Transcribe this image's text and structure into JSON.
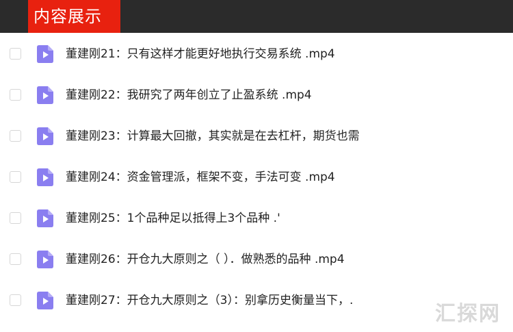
{
  "header": {
    "tab_label": "内容展示"
  },
  "files": [
    {
      "name": "董建刚21：只有这样才能更好地执行交易系统 .mp4"
    },
    {
      "name": "董建刚22：我研究了两年创立了止盈系统 .mp4"
    },
    {
      "name": "董建刚23：计算最大回撤，其实就是在去杠杆，期货也需"
    },
    {
      "name": "董建刚24：资金管理派，框架不变，手法可变 .mp4"
    },
    {
      "name": "董建刚25：1个品种足以抵得上3个品种 .'"
    },
    {
      "name": "董建刚26：开仓九大原则之（ ）．做熟悉的品种 .mp4"
    },
    {
      "name": "董建刚27：开仓九大原则之（3）：别拿历史衡量当下，."
    }
  ],
  "watermark": "汇探网",
  "colors": {
    "header_bg": "#2b2b2b",
    "tab_bg": "#e8210f",
    "icon_bg": "#8a7ef0"
  },
  "icons": {
    "file": "video-file-icon"
  }
}
